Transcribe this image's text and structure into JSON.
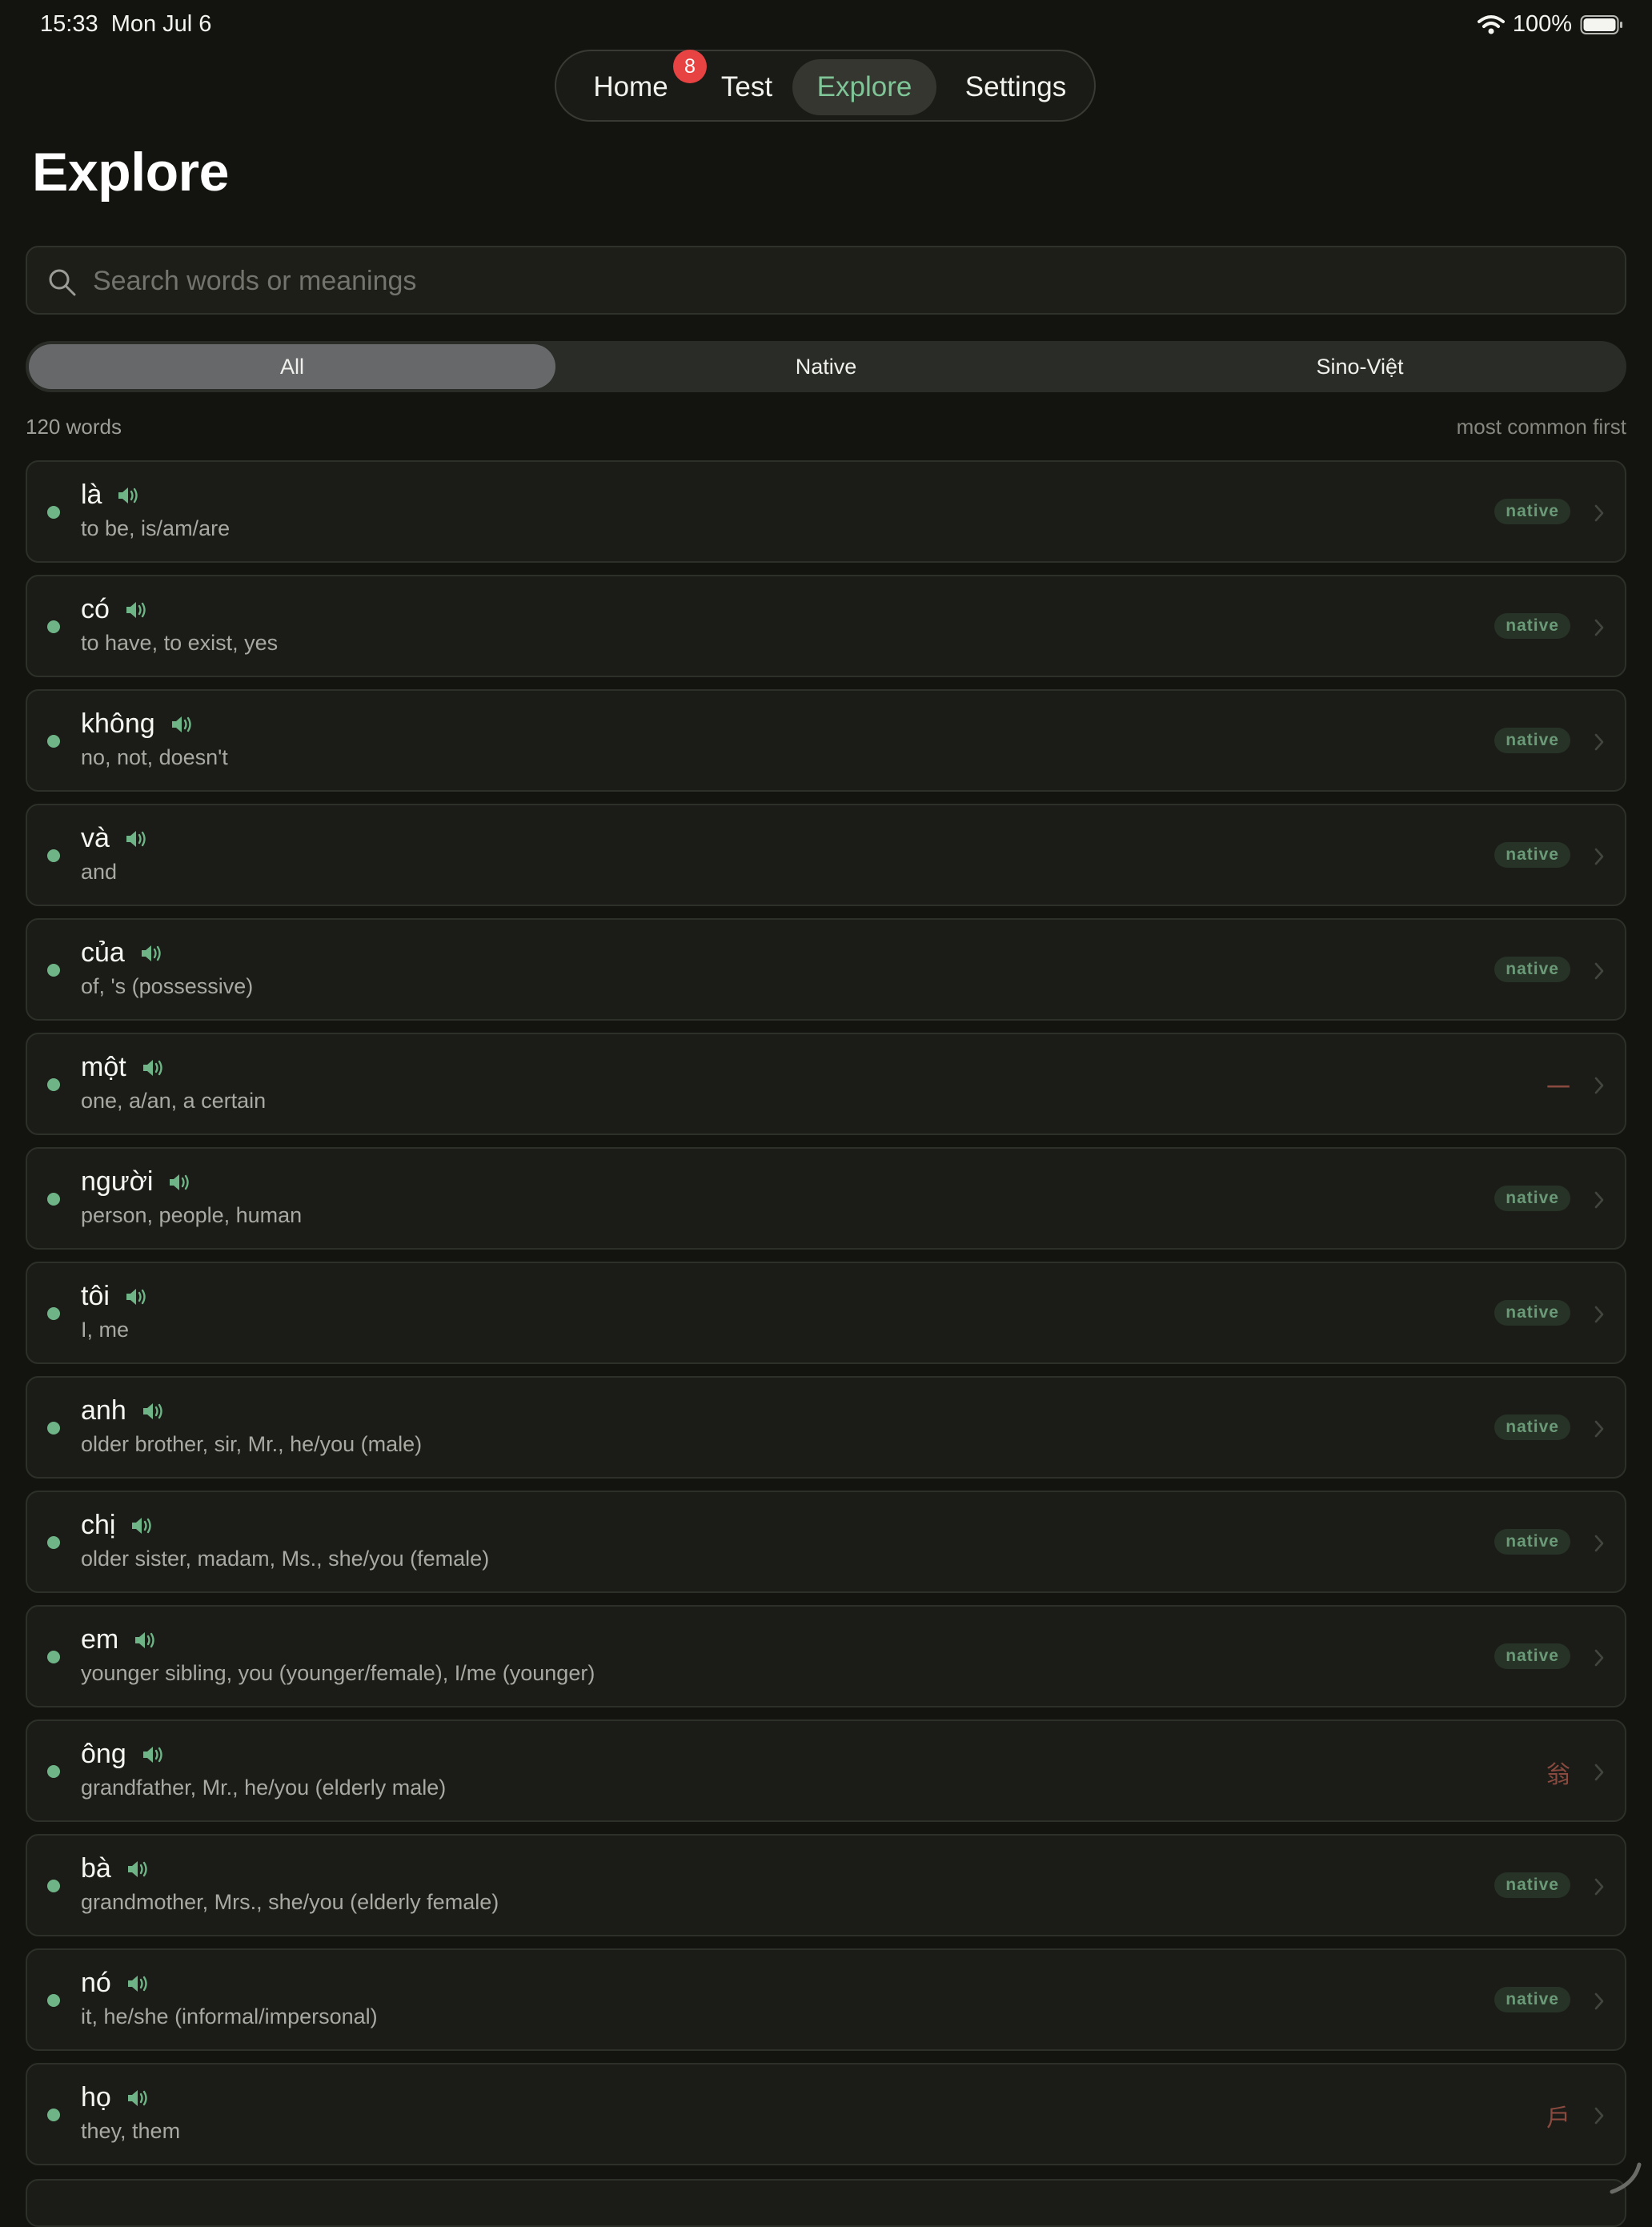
{
  "status_bar": {
    "time": "15:33",
    "date": "Mon Jul 6",
    "battery": "100%"
  },
  "nav": {
    "tabs": [
      {
        "label": "Home",
        "badge": "8"
      },
      {
        "label": "Test"
      },
      {
        "label": "Explore",
        "active": true
      },
      {
        "label": "Settings"
      }
    ]
  },
  "page": {
    "title": "Explore"
  },
  "search": {
    "placeholder": "Search words or meanings",
    "value": ""
  },
  "filter": {
    "options": [
      "All",
      "Native",
      "Sino-Việt"
    ],
    "selected": "All"
  },
  "meta": {
    "count": "120 words",
    "sort": "most common first"
  },
  "colors": {
    "accent": "#7fc597",
    "badge": "#e84343",
    "background": "#13140f"
  },
  "words": [
    {
      "word": "là",
      "meaning": "to be, is/am/are",
      "origin": "native"
    },
    {
      "word": "có",
      "meaning": "to have, to exist, yes",
      "origin": "native"
    },
    {
      "word": "không",
      "meaning": "no, not, doesn't",
      "origin": "native"
    },
    {
      "word": "và",
      "meaning": "and",
      "origin": "native"
    },
    {
      "word": "của",
      "meaning": "of, 's (possessive)",
      "origin": "native"
    },
    {
      "word": "một",
      "meaning": "one, a/an, a certain",
      "origin": "一"
    },
    {
      "word": "người",
      "meaning": "person, people, human",
      "origin": "native"
    },
    {
      "word": "tôi",
      "meaning": "I, me",
      "origin": "native"
    },
    {
      "word": "anh",
      "meaning": "older brother, sir, Mr., he/you (male)",
      "origin": "native"
    },
    {
      "word": "chị",
      "meaning": "older sister, madam, Ms., she/you (female)",
      "origin": "native"
    },
    {
      "word": "em",
      "meaning": "younger sibling, you (younger/female), I/me (younger)",
      "origin": "native"
    },
    {
      "word": "ông",
      "meaning": "grandfather, Mr., he/you (elderly male)",
      "origin": "翁"
    },
    {
      "word": "bà",
      "meaning": "grandmother, Mrs., she/you (elderly female)",
      "origin": "native"
    },
    {
      "word": "nó",
      "meaning": "it, he/she (informal/impersonal)",
      "origin": "native"
    },
    {
      "word": "họ",
      "meaning": "they, them",
      "origin": "戶"
    }
  ]
}
